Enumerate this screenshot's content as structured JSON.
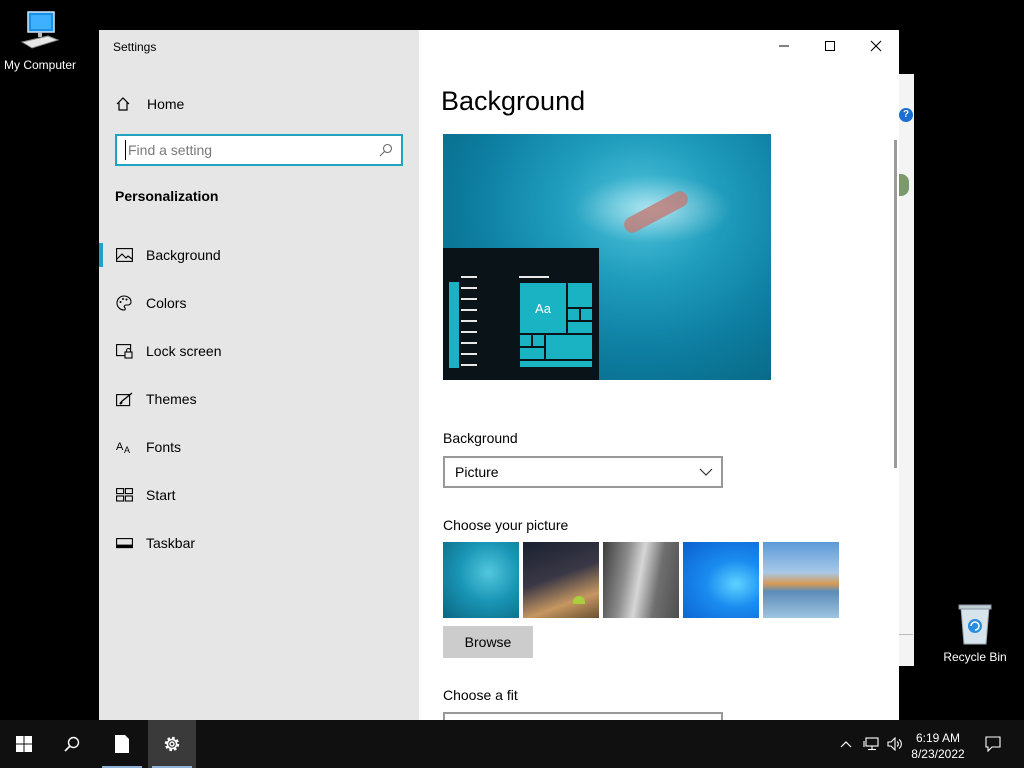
{
  "desktop": {
    "icons": [
      {
        "label": "My Computer"
      },
      {
        "label": "Recycle Bin"
      }
    ]
  },
  "window": {
    "title": "Settings",
    "controls": [
      "minimize",
      "maximize",
      "close"
    ]
  },
  "sidebar": {
    "home_label": "Home",
    "search_placeholder": "Find a setting",
    "section_title": "Personalization",
    "items": [
      {
        "label": "Background",
        "icon": "picture-icon",
        "selected": true
      },
      {
        "label": "Colors",
        "icon": "palette-icon",
        "selected": false
      },
      {
        "label": "Lock screen",
        "icon": "lock-screen-icon",
        "selected": false
      },
      {
        "label": "Themes",
        "icon": "themes-icon",
        "selected": false
      },
      {
        "label": "Fonts",
        "icon": "fonts-icon",
        "selected": false
      },
      {
        "label": "Start",
        "icon": "start-icon",
        "selected": false
      },
      {
        "label": "Taskbar",
        "icon": "taskbar-icon",
        "selected": false
      }
    ]
  },
  "main": {
    "title": "Background",
    "preview": {
      "tile_text": "Aa"
    },
    "background_label": "Background",
    "background_value": "Picture",
    "choose_picture_label": "Choose your picture",
    "pictures": [
      "underwater-swimmer",
      "night-sky-tent",
      "rock-cliff",
      "windows-blue",
      "beach-rocks"
    ],
    "browse_label": "Browse",
    "choose_fit_label": "Choose a fit"
  },
  "taskbar": {
    "time": "6:19 AM",
    "date": "8/23/2022"
  },
  "colors": {
    "accent": "#20a3c2",
    "sidebar_bg": "#e6e6e6",
    "taskbar_bg": "#101010"
  }
}
